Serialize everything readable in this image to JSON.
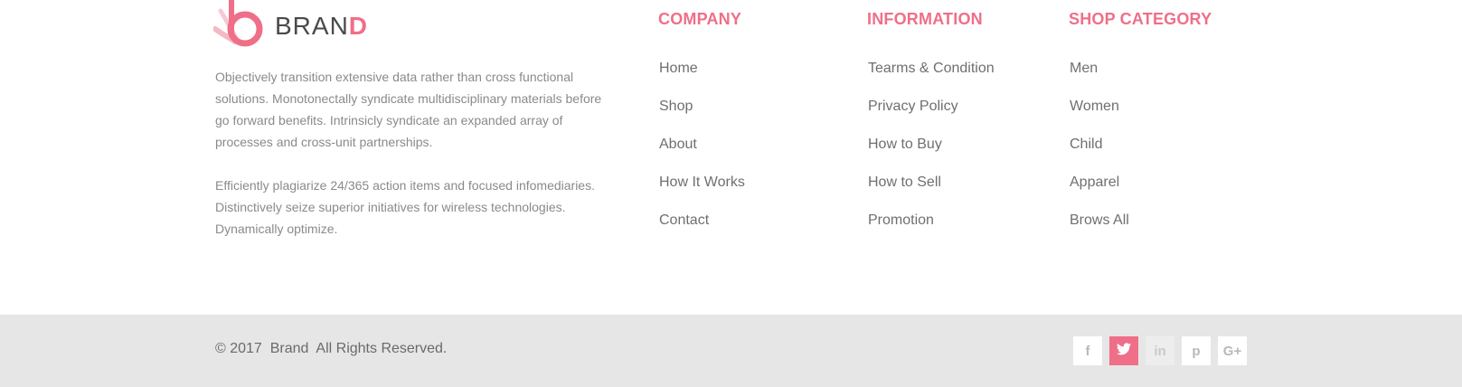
{
  "brand": {
    "name_main": "BRAN",
    "name_accent": "D",
    "accent_color": "#ef6f88"
  },
  "about": {
    "paragraph1": "Objectively transition extensive data rather than cross functional solutions. Monotonectally syndicate multidisciplinary materials before go forward benefits. Intrinsicly syndicate an expanded array of processes and cross-unit partnerships.",
    "paragraph2": "Efficiently plagiarize 24/365 action items and focused infomediaries. Distinctively seize superior initiatives for wireless technologies. Dynamically optimize."
  },
  "columns": {
    "company": {
      "title": "COMPANY",
      "links": [
        "Home",
        "Shop",
        "About",
        "How It Works",
        "Contact"
      ]
    },
    "information": {
      "title": "INFORMATION",
      "links": [
        "Tearms & Condition",
        "Privacy Policy",
        "How to Buy",
        "How to Sell",
        "Promotion"
      ]
    },
    "shop": {
      "title": "SHOP CATEGORY",
      "links": [
        "Men",
        "Women",
        "Child",
        "Apparel",
        "Brows All"
      ]
    }
  },
  "footer": {
    "copyright": "© 2017  Brand  All Rights Reserved."
  },
  "social": {
    "items": [
      {
        "icon": "facebook-icon",
        "glyph": "f",
        "state": "default"
      },
      {
        "icon": "twitter-icon",
        "glyph": "",
        "state": "active"
      },
      {
        "icon": "linkedin-icon",
        "glyph": "in",
        "state": "muted"
      },
      {
        "icon": "pinterest-icon",
        "glyph": "p",
        "state": "default"
      },
      {
        "icon": "google-plus-icon",
        "glyph": "G+",
        "state": "default"
      }
    ]
  }
}
